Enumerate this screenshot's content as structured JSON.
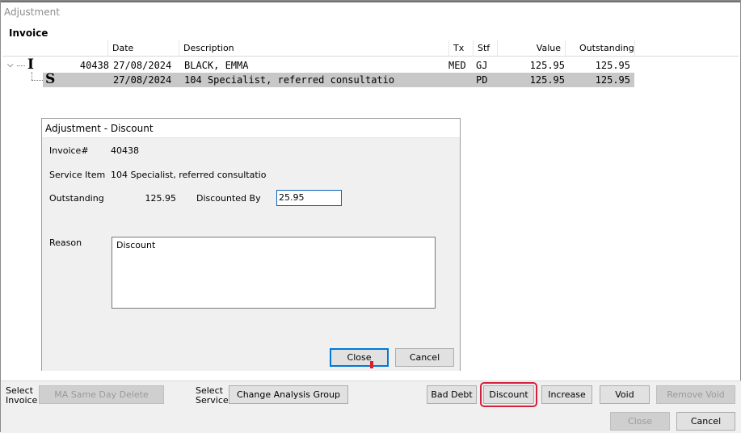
{
  "window": {
    "title": "Adjustment"
  },
  "invoice_section": {
    "label": "Invoice"
  },
  "grid": {
    "columns": {
      "date": "Date",
      "description": "Description",
      "tx": "Tx",
      "stf": "Stf",
      "value": "Value",
      "outstanding": "Outstanding"
    },
    "rows": [
      {
        "type_glyph": "I",
        "number": "40438",
        "date": "27/08/2024",
        "description": "BLACK, EMMA",
        "tx": "MED",
        "stf": "GJ",
        "value": "125.95",
        "outstanding": "125.95"
      },
      {
        "type_glyph": "S",
        "number": "",
        "date": "27/08/2024",
        "description": "104 Specialist, referred consultatio",
        "tx": "",
        "stf": "PD",
        "value": "125.95",
        "outstanding": "125.95"
      }
    ]
  },
  "dialog": {
    "title": "Adjustment - Discount",
    "invoice_label": "Invoice#",
    "invoice_value": "40438",
    "service_label": "Service Item",
    "service_value": "104 Specialist, referred consultatio",
    "outstanding_label": "Outstanding",
    "outstanding_value": "125.95",
    "discounted_by_label": "Discounted By",
    "discounted_by_value": "25.95",
    "reason_label": "Reason",
    "reason_value": "Discount",
    "close_label": "Close",
    "cancel_label": "Cancel"
  },
  "bottom": {
    "select_invoice_label_1": "Select",
    "select_invoice_label_2": "Invoice",
    "ma_same_day_delete": "MA Same Day Delete",
    "select_service_label_1": "Select",
    "select_service_label_2": "Service",
    "change_analysis_group": "Change Analysis Group",
    "bad_debt": "Bad Debt",
    "discount": "Discount",
    "increase": "Increase",
    "void": "Void",
    "remove_void": "Remove Void",
    "close": "Close",
    "cancel": "Cancel"
  },
  "colors": {
    "highlight": "#d4213d",
    "focus": "#0078d7",
    "selected_row": "#c8c8c8"
  }
}
